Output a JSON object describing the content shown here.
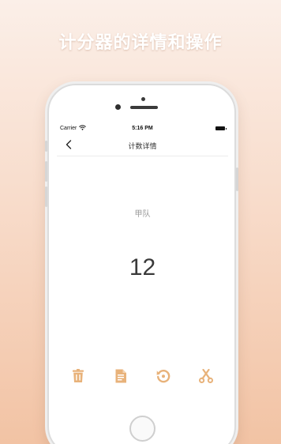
{
  "promo": {
    "title": "计分器的详情和操作"
  },
  "status_bar": {
    "carrier": "Carrier",
    "time": "5:16 PM"
  },
  "nav": {
    "title": "计数详情"
  },
  "counter": {
    "team_name": "甲队",
    "score": "12"
  },
  "toolbar": {
    "accent_color": "#e8b27a",
    "icons": [
      "trash-icon",
      "document-icon",
      "reset-icon",
      "scissors-icon"
    ]
  },
  "colors": {
    "background_top": "#fbefe8",
    "background_bottom": "#f2c3a4",
    "score_text": "#3a3a3a"
  }
}
